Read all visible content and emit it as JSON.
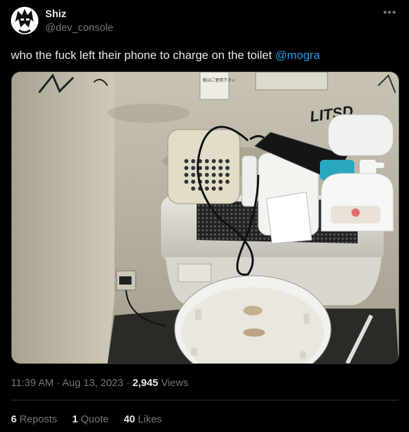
{
  "author": {
    "name": "Shiz",
    "handle": "@dev_console"
  },
  "more_icon": "more-horizontal-icon",
  "tweet": {
    "text": "who the fuck left their phone to charge on the toilet ",
    "mention": "@mogra"
  },
  "meta": {
    "time": "11:39 AM",
    "sep1": "·",
    "date": "Aug 13, 2023",
    "sep2": "·",
    "views_count": "2,945",
    "views_label": "Views"
  },
  "stats": {
    "reposts_count": "6",
    "reposts_label": "Reposts",
    "quotes_count": "1",
    "quotes_label": "Quote",
    "likes_count": "40",
    "likes_label": "Likes"
  },
  "photo": {
    "wall_graffiti": "LITSD",
    "sign_text": "紙はご使用下さい"
  }
}
